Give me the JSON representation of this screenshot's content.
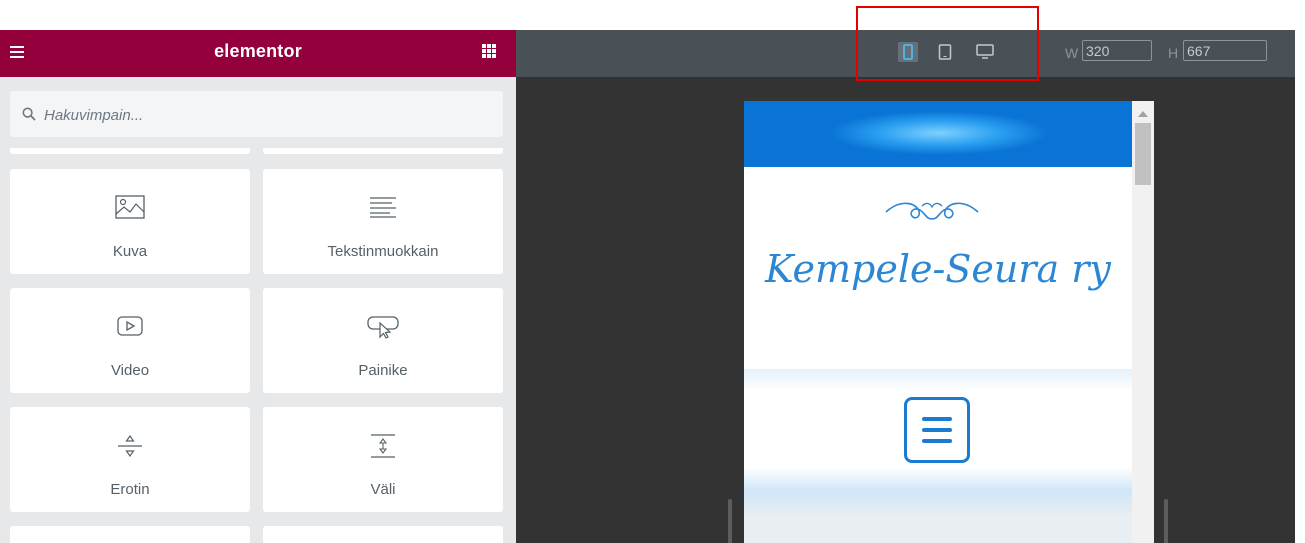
{
  "app": {
    "brand": "elementor"
  },
  "icons": {
    "menu": "hamburger-icon",
    "apps": "grid-icon",
    "search": "search-icon",
    "mobile": "mobile-icon",
    "tablet": "tablet-icon",
    "desktop": "desktop-icon"
  },
  "colors": {
    "brand": "#93003c",
    "toolbar": "#495157",
    "canvas": "#333333",
    "highlight": "#e50000",
    "site_accent": "#2b86d3"
  },
  "search": {
    "placeholder": "Hakuvimpain..."
  },
  "widgets": [
    {
      "label": "Kuva",
      "icon": "image-icon"
    },
    {
      "label": "Tekstinmuokkain",
      "icon": "text-editor-icon"
    },
    {
      "label": "Video",
      "icon": "video-icon"
    },
    {
      "label": "Painike",
      "icon": "button-icon"
    },
    {
      "label": "Erotin",
      "icon": "divider-icon"
    },
    {
      "label": "Väli",
      "icon": "spacer-icon"
    }
  ],
  "responsive": {
    "active_device": "mobile",
    "width_label": "W",
    "width_value": "320",
    "height_label": "H",
    "height_value": "667"
  },
  "preview": {
    "site_title": "Kempele-Seura ry"
  }
}
